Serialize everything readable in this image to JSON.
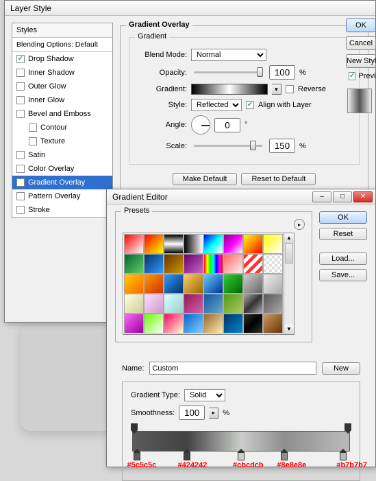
{
  "layerStyle": {
    "title": "Layer Style",
    "stylesHeader": "Styles",
    "blendingOptions": "Blending Options: Default",
    "items": [
      {
        "label": "Drop Shadow",
        "checked": true,
        "selected": false
      },
      {
        "label": "Inner Shadow",
        "checked": false,
        "selected": false
      },
      {
        "label": "Outer Glow",
        "checked": false,
        "selected": false
      },
      {
        "label": "Inner Glow",
        "checked": false,
        "selected": false
      },
      {
        "label": "Bevel and Emboss",
        "checked": false,
        "selected": false
      },
      {
        "label": "Contour",
        "checked": false,
        "selected": false,
        "indent": true
      },
      {
        "label": "Texture",
        "checked": false,
        "selected": false,
        "indent": true
      },
      {
        "label": "Satin",
        "checked": false,
        "selected": false
      },
      {
        "label": "Color Overlay",
        "checked": false,
        "selected": false
      },
      {
        "label": "Gradient Overlay",
        "checked": true,
        "selected": true
      },
      {
        "label": "Pattern Overlay",
        "checked": false,
        "selected": false
      },
      {
        "label": "Stroke",
        "checked": false,
        "selected": false
      }
    ],
    "rightButtons": {
      "ok": "OK",
      "cancel": "Cancel",
      "newStyle": "New Style...",
      "preview": "Preview"
    },
    "overlay": {
      "groupTitle": "Gradient Overlay",
      "subTitle": "Gradient",
      "blendModeLabel": "Blend Mode:",
      "blendMode": "Normal",
      "opacityLabel": "Opacity:",
      "opacity": "100",
      "pct": "%",
      "gradientLabel": "Gradient:",
      "reverseLabel": "Reverse",
      "styleLabel": "Style:",
      "style": "Reflected",
      "alignLabel": "Align with Layer",
      "angleLabel": "Angle:",
      "angle": "0",
      "deg": "°",
      "scaleLabel": "Scale:",
      "scale": "150",
      "makeDefault": "Make Default",
      "resetDefault": "Reset to Default"
    }
  },
  "gradEditor": {
    "title": "Gradient Editor",
    "presetsTitle": "Presets",
    "buttons": {
      "ok": "OK",
      "reset": "Reset",
      "load": "Load...",
      "save": "Save..."
    },
    "nameLabel": "Name:",
    "name": "Custom",
    "new": "New",
    "gradTypeLabel": "Gradient Type:",
    "gradType": "Solid",
    "smoothLabel": "Smoothness:",
    "smooth": "100",
    "pct": "%",
    "presets_css": [
      "linear-gradient(135deg,#ff0000,#fff)",
      "linear-gradient(135deg,#ff0000,#ff8000,#ffff00)",
      "linear-gradient(#000,#fff,#000)",
      "linear-gradient(90deg,#000,#fff)",
      "linear-gradient(135deg,#00f,#0ff,#fff)",
      "linear-gradient(135deg,#808,#f0f,#fff)",
      "linear-gradient(135deg,#ff0,#f80,#f00)",
      "linear-gradient(135deg,#ff0,#fff)",
      "linear-gradient(135deg,#063,#6c6)",
      "linear-gradient(135deg,#036,#39f)",
      "linear-gradient(135deg,#630,#c90)",
      "linear-gradient(135deg,#606,#c6c)",
      "linear-gradient(90deg,#f00,#ff0,#0f0,#0ff,#00f,#f0f,#f00)",
      "linear-gradient(135deg,#f66,#fee)",
      "repeating-linear-gradient(135deg,#f33 0 5px,#fff 5px 10px)",
      "repeating-conic-gradient(#ddd 0 25%,#fff 0 50%) 0/8px 8px",
      "linear-gradient(135deg,#fc0,#f60)",
      "linear-gradient(135deg,#f90,#c30)",
      "linear-gradient(135deg,#39f,#036)",
      "linear-gradient(135deg,#fc6,#960)",
      "linear-gradient(135deg,#6cf,#039)",
      "linear-gradient(135deg,#3c3,#060)",
      "linear-gradient(135deg,#ccc,#666)",
      "linear-gradient(135deg,#eee,#aaa)",
      "linear-gradient(135deg,#ffd,#cc9)",
      "linear-gradient(135deg,#fdf,#c9c)",
      "linear-gradient(135deg,#dff,#9cc)",
      "linear-gradient(135deg,#915,#c6a)",
      "linear-gradient(135deg,#159,#6ac)",
      "linear-gradient(135deg,#591,#ac6)",
      "linear-gradient(135deg,#aaa,#333,#aaa)",
      "linear-gradient(135deg,#555,#aaa)",
      "linear-gradient(135deg,#f6f,#909)",
      "linear-gradient(135deg,#6f0,#fff)",
      "linear-gradient(135deg,#f06,#ffc)",
      "linear-gradient(135deg,#06c,#8cf)",
      "linear-gradient(135deg,#963,#fea)",
      "linear-gradient(135deg,#036,#08c)",
      "linear-gradient(135deg,#333,#000,#333)",
      "linear-gradient(135deg,#c96,#630)"
    ],
    "stops": [
      {
        "hex": "#5c5c5c",
        "pos": 2
      },
      {
        "hex": "#424242",
        "pos": 25
      },
      {
        "hex": "#cbcdcb",
        "pos": 50
      },
      {
        "hex": "#8e8e8e",
        "pos": 70
      },
      {
        "hex": "#b7b7b7",
        "pos": 97
      }
    ]
  }
}
